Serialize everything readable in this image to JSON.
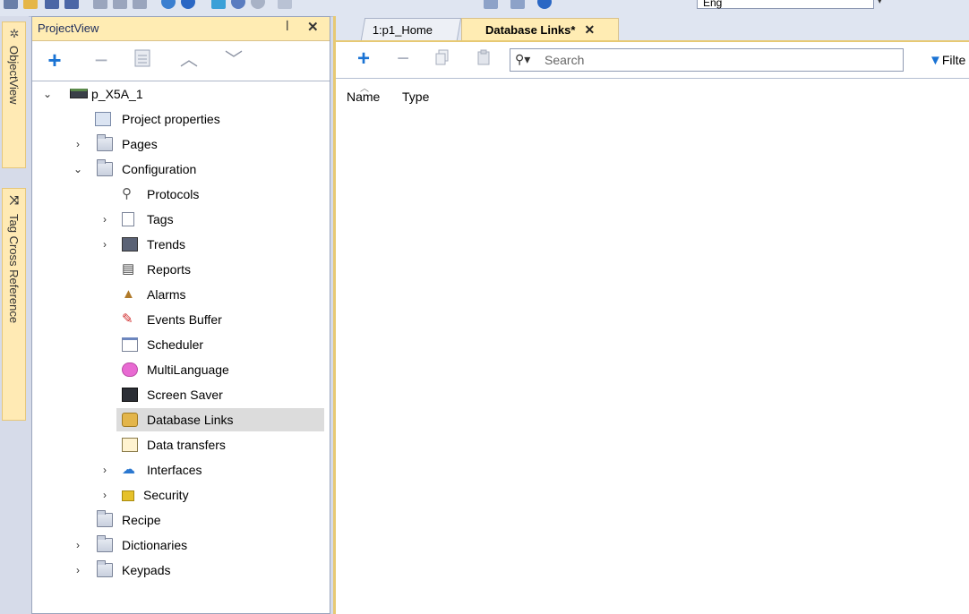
{
  "toolbar": {
    "language_value": "Eng"
  },
  "side_tabs": [
    {
      "label": "ObjectView"
    },
    {
      "label": "Tag Cross Reference"
    }
  ],
  "project_view": {
    "title": "ProjectView",
    "toolbar": [
      "add",
      "remove",
      "properties",
      "move-up",
      "move-down"
    ],
    "tree": [
      {
        "label": "p_X5A_1",
        "icon": "device-icon",
        "expander": "expanded"
      },
      {
        "label": "Project properties",
        "icon": "project-properties-icon",
        "expander": "none"
      },
      {
        "label": "Pages",
        "icon": "folder-icon",
        "expander": "collapsed"
      },
      {
        "label": "Configuration",
        "icon": "folder-icon",
        "expander": "expanded"
      },
      {
        "label": "Protocols",
        "icon": "protocols-icon",
        "expander": "none"
      },
      {
        "label": "Tags",
        "icon": "tags-icon",
        "expander": "collapsed"
      },
      {
        "label": "Trends",
        "icon": "trends-icon",
        "expander": "collapsed"
      },
      {
        "label": "Reports",
        "icon": "printer-icon",
        "expander": "none"
      },
      {
        "label": "Alarms",
        "icon": "bell-icon",
        "expander": "none"
      },
      {
        "label": "Events Buffer",
        "icon": "pin-icon",
        "expander": "none"
      },
      {
        "label": "Scheduler",
        "icon": "calendar-icon",
        "expander": "none"
      },
      {
        "label": "MultiLanguage",
        "icon": "speech-bubble-icon",
        "expander": "none"
      },
      {
        "label": "Screen Saver",
        "icon": "screen-saver-icon",
        "expander": "none"
      },
      {
        "label": "Database Links",
        "icon": "database-icon",
        "expander": "none",
        "selected": true
      },
      {
        "label": "Data transfers",
        "icon": "data-transfer-icon",
        "expander": "none"
      },
      {
        "label": "Interfaces",
        "icon": "cloud-icon",
        "expander": "collapsed"
      },
      {
        "label": "Security",
        "icon": "lock-icon",
        "expander": "collapsed"
      },
      {
        "label": "Recipe",
        "icon": "folder-icon",
        "expander": "none"
      },
      {
        "label": "Dictionaries",
        "icon": "folder-icon",
        "expander": "collapsed"
      },
      {
        "label": "Keypads",
        "icon": "folder-icon",
        "expander": "collapsed"
      }
    ]
  },
  "tabs": [
    {
      "label": "1:p1_Home",
      "active": false
    },
    {
      "label": "Database Links*",
      "active": true
    }
  ],
  "database_links": {
    "search_placeholder": "Search",
    "filter_label": "Filte",
    "columns": [
      "Name",
      "Type"
    ]
  },
  "colors": {
    "accent": "#ffecb3",
    "selection": "#dcdcdc",
    "add_blue": "#1a73d4"
  }
}
